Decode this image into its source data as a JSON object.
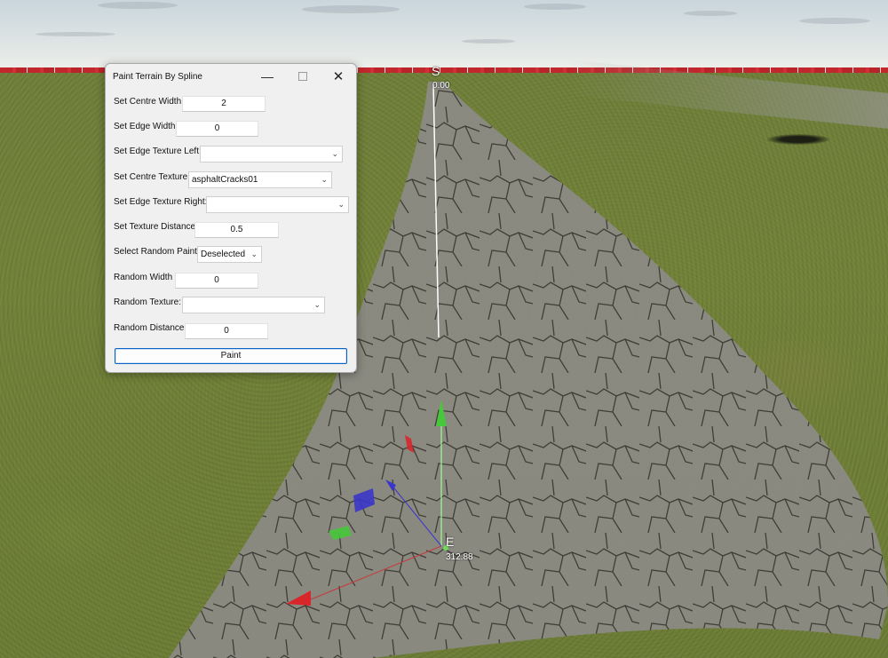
{
  "window": {
    "title": "Paint Terrain By Spline",
    "minimize_glyph": "—",
    "close_glyph": "✕"
  },
  "form": {
    "centre_width": {
      "label": "Set Centre Width",
      "value": "2"
    },
    "edge_width": {
      "label": "Set Edge Width",
      "value": "0"
    },
    "edge_texture_left": {
      "label": "Set Edge Texture Left:",
      "value": ""
    },
    "centre_texture": {
      "label": "Set Centre Texture:",
      "value": "asphaltCracks01"
    },
    "edge_texture_right": {
      "label": "Set Edge Texture Right:",
      "value": ""
    },
    "texture_distance": {
      "label": "Set Texture Distance",
      "value": "0.5"
    },
    "random_paint": {
      "label": "Select Random Paint",
      "value": "Deselected"
    },
    "random_width": {
      "label": "Random Width",
      "value": "0"
    },
    "random_texture": {
      "label": "Random Texture:",
      "value": ""
    },
    "random_distance": {
      "label": "Random Distance",
      "value": "0"
    },
    "paint_button": "Paint"
  },
  "viewport": {
    "start_marker": "S",
    "start_distance": "0.00",
    "end_marker": "E",
    "end_distance": "312.88"
  },
  "icons": [
    "minimize-icon",
    "maximize-icon",
    "close-icon",
    "chevron-down-icon"
  ],
  "colors": {
    "accent": "#0a64c8",
    "axis_x": "#d8262b",
    "axis_y": "#46c83a",
    "axis_z": "#3b36c9"
  }
}
